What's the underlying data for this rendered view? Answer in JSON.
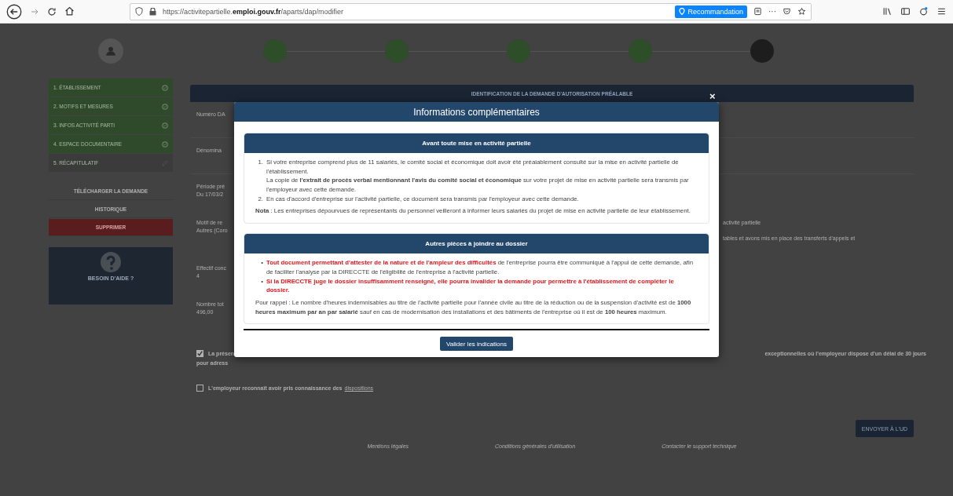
{
  "browser": {
    "url": "https://activitepartielle.**emploi.gouv.fr**/aparts/dap/modifier",
    "recommendation": "Recommandation",
    "more": "···"
  },
  "steps": [
    {
      "done": true
    },
    {
      "done": true
    },
    {
      "done": true
    },
    {
      "done": true
    },
    {
      "done": false
    }
  ],
  "sidebar": {
    "items": [
      {
        "label": "1. ÉTABLISSEMENT",
        "done": true
      },
      {
        "label": "2. MOTIFS ET MESURES",
        "done": true
      },
      {
        "label": "3. INFOS ACTIVITÉ PARTI",
        "done": true
      },
      {
        "label": "4. ESPACE DOCUMENTAIRE",
        "done": true
      },
      {
        "label": "5. RÉCAPITULATIF",
        "done": false
      }
    ],
    "actions": [
      {
        "label": "TÉLÉCHARGER LA DEMANDE",
        "kind": "plain"
      },
      {
        "label": "HISTORIQUE",
        "kind": "plain"
      },
      {
        "label": "SUPPRIMER",
        "kind": "danger"
      }
    ],
    "help": {
      "title": "BESOIN D'AIDE ?"
    }
  },
  "main": {
    "header": "IDENTIFICATION DE LA DEMANDE D'AUTORISATION PRÉALABLE",
    "fields": [
      {
        "label": "Numéro DA"
      },
      {
        "label": "Dénomina"
      },
      {
        "label": "Période pré",
        "value": "Du 17/03/2"
      },
      {
        "label": "Motif de re",
        "value": "Autres (Coro",
        "right_label": "activité partielle",
        "right_value": "tables et avons mis en place des transferts d'appels et"
      },
      {
        "label": "Effectif conc",
        "value": "4"
      },
      {
        "label": "Nombre tot",
        "value": "496,00"
      }
    ],
    "checks": [
      {
        "text": "La présen",
        "right_text": "exceptionnelles où l'employeur dispose d'un délai de 30 jours",
        "continuation": "pour adress",
        "checked": true
      },
      {
        "text": "L'employeur reconnaît avoir pris connaissance des",
        "link": "dispositions",
        "checked": false
      }
    ],
    "submit": "ENVOYER À L'UD",
    "footer": [
      "Mentions légales",
      "Conditions générales d'utilisation",
      "Contacter le support technique"
    ]
  },
  "modal": {
    "title": "Informations complémentaires",
    "close": "×",
    "section_1": {
      "title": "Avant toute mise en activité partielle",
      "items": [
        {
          "marker": "1.",
          "text": "Si votre entreprise comprend plus de 11 salariés, le comité social et économique doit avoir été préalablement consulté sur la mise en activité partielle de l'établissement.\nLa copie de **l'extrait de procès verbal mentionnant l'avis du comité social et économique** sur votre projet de mise en activité partielle sera transmis par l'employeur avec cette demande."
        },
        {
          "marker": "2.",
          "text": "En cas d'accord d'entreprise sur l'activité partielle, ce document sera transmis par l'employeur avec cette demande."
        }
      ],
      "note": "**Nota** : Les entreprises dépourvues de représentants du personnel veilleront à informer leurs salariés du projet de mise en activité partielle de leur établissement."
    },
    "section_2": {
      "title": "Autres pièces à joindre au dossier",
      "bullets": [
        {
          "marker": "•",
          "emphasis": "Tout document permettant d'attester de la nature et de l'ampleur des difficultés",
          "text": " de l'entreprise pourra être communiqué à l'appui de cette demande, afin de faciliter l'analyse par la DIRECCTE de l'éligibilité de l'entreprise à l'activité partielle."
        },
        {
          "marker": "•",
          "emphasis": "Si la DIRECCTE juge le dossier insuffisamment renseigné, elle pourra invalider la demande pour permettre à l'établissement de compléter le dossier."
        }
      ],
      "reminder": "Pour rappel : Le nombre d'heures indemnisables au titre de l'activité partielle pour l'année civile au titre de la réduction ou de la suspension d'activité est de **1000 heures maximum par an par salarié** sauf en cas de modernisation des installations et des bâtiments de l'entreprise où il est de **100 heures** maximum."
    },
    "button": "Valider les indications"
  }
}
